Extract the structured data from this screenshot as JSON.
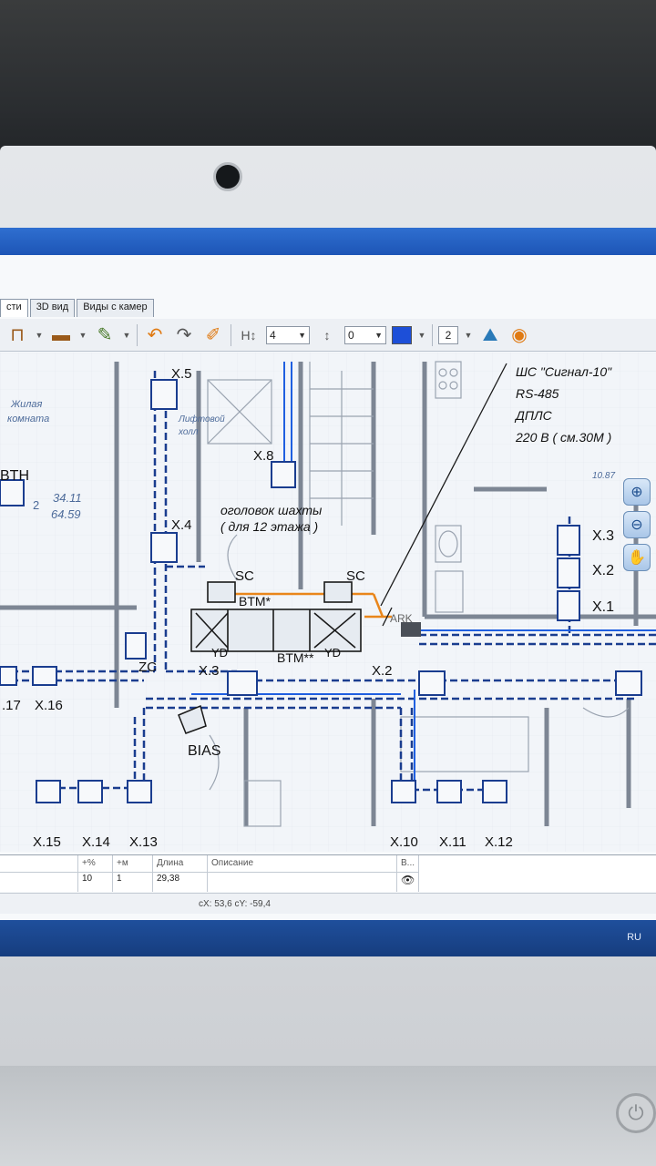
{
  "tabs": [
    {
      "label": "сти"
    },
    {
      "label": "3D вид"
    },
    {
      "label": "Виды с камер"
    }
  ],
  "toolbar": {
    "layer_value": "4",
    "offset_value": "0",
    "count_value": "2",
    "color": "#1d4fd8"
  },
  "annotation": {
    "line1": "ШС \"Сигнал-10\"",
    "line2": "RS-485",
    "line3": "ДПЛС",
    "line4": "220 В ( см.30М )"
  },
  "labels": {
    "x5": "X.5",
    "x4": "X.4",
    "x8": "X.8",
    "x3r": "X.3",
    "x2r": "X.2",
    "x1r": "X.1",
    "x3": "X.3",
    "x2": "X.2",
    "x17": ".17",
    "x16": "X.16",
    "x15": "X.15",
    "x14": "X.14",
    "x13": "X.13",
    "x10": "X.10",
    "x11": "X.11",
    "x12": "X.12",
    "sc1": "SC",
    "sc2": "SC",
    "btm1": "BTM*",
    "btm2": "BTM**",
    "yd1": "YD",
    "yd2": "YD",
    "zc": "ZC",
    "bias": "BIAS",
    "btn": "BTH",
    "ark": "ARK",
    "shaft1": "оголовок шахты",
    "shaft2": "( для  12 этажа )",
    "room1": "Жилая",
    "room2": "комната",
    "lift1": "Лифтовой",
    "lift2": "холл",
    "area1": "34.11",
    "area2": "64.59",
    "area3": "10.87",
    "num2": "2"
  },
  "table": {
    "headers": {
      "pct": "+%",
      "m": "+м",
      "length": "Длина",
      "desc": "Описание",
      "vis": "В..."
    },
    "row": {
      "pct": "10",
      "m": "1",
      "length": "29,38",
      "desc": ""
    }
  },
  "status": {
    "coords": "cX: 53,6 cY: -59,4"
  },
  "taskbar": {
    "lang": "RU"
  }
}
